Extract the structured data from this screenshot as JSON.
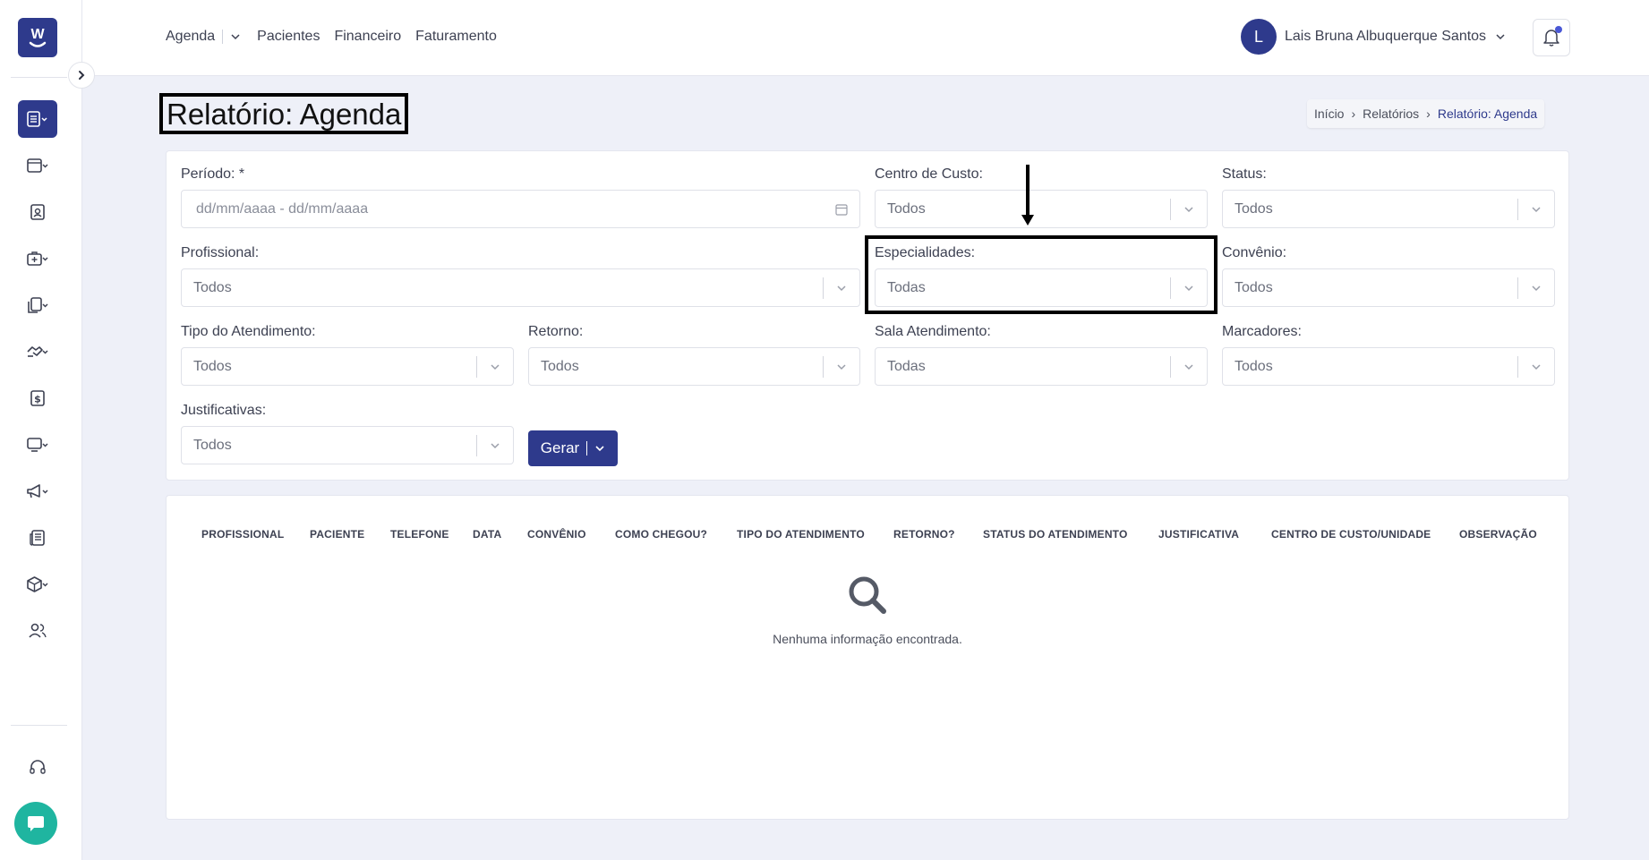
{
  "app": {
    "brand_color": "#2e3a8c",
    "accent_color": "#1fb5a0"
  },
  "sidebar": {
    "items": [
      {
        "icon": "report-icon",
        "active": true
      },
      {
        "icon": "calendar-icon",
        "active": false
      },
      {
        "icon": "patient-card-icon",
        "active": false
      },
      {
        "icon": "medical-bag-icon",
        "active": false
      },
      {
        "icon": "documents-icon",
        "active": false
      },
      {
        "icon": "handshake-icon",
        "active": false
      },
      {
        "icon": "dollar-icon",
        "active": false
      },
      {
        "icon": "monitor-icon",
        "active": false
      },
      {
        "icon": "megaphone-icon",
        "active": false
      },
      {
        "icon": "news-icon",
        "active": false
      },
      {
        "icon": "box-icon",
        "active": false
      },
      {
        "icon": "users-icon",
        "active": false
      }
    ],
    "support_icon": "headset-icon",
    "chat_icon": "chat-icon"
  },
  "topnav": {
    "items": [
      "Agenda",
      "Pacientes",
      "Financeiro",
      "Faturamento"
    ]
  },
  "user": {
    "initial": "L",
    "name": "Lais Bruna Albuquerque Santos"
  },
  "header": {
    "title": "Relatório: Agenda",
    "breadcrumb": [
      "Início",
      "Relatórios",
      "Relatório: Agenda"
    ]
  },
  "filters": {
    "periodo": {
      "label": "Período: *",
      "placeholder": "dd/mm/aaaa - dd/mm/aaaa"
    },
    "centro_custo": {
      "label": "Centro de Custo:",
      "value": "Todos"
    },
    "status": {
      "label": "Status:",
      "value": "Todos"
    },
    "profissional": {
      "label": "Profissional:",
      "value": "Todos"
    },
    "especialidades": {
      "label": "Especialidades:",
      "value": "Todas"
    },
    "convenio": {
      "label": "Convênio:",
      "value": "Todos"
    },
    "tipo_atendimento": {
      "label": "Tipo do Atendimento:",
      "value": "Todos"
    },
    "retorno": {
      "label": "Retorno:",
      "value": "Todos"
    },
    "sala_atendimento": {
      "label": "Sala Atendimento:",
      "value": "Todas"
    },
    "marcadores": {
      "label": "Marcadores:",
      "value": "Todos"
    },
    "justificativas": {
      "label": "Justificativas:",
      "value": "Todos"
    },
    "gerar_label": "Gerar"
  },
  "table": {
    "columns": [
      "PROFISSIONAL",
      "PACIENTE",
      "TELEFONE",
      "DATA",
      "CONVÊNIO",
      "COMO CHEGOU?",
      "TIPO DO ATENDIMENTO",
      "RETORNO?",
      "STATUS DO ATENDIMENTO",
      "JUSTIFICATIVA",
      "CENTRO DE CUSTO/UNIDADE",
      "OBSERVAÇÃO"
    ],
    "empty_message": "Nenhuma informação encontrada."
  }
}
